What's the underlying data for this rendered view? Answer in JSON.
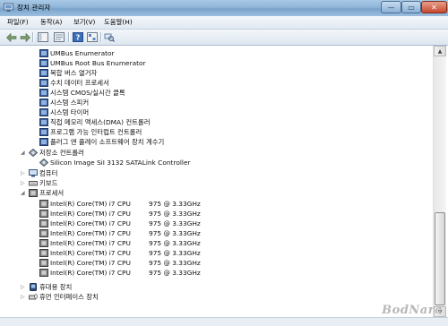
{
  "window": {
    "title": "장치 관리자",
    "buttons": {
      "minimize": "—",
      "maximize": "▭",
      "close": "✕"
    }
  },
  "menu": [
    {
      "label": "파일(F)"
    },
    {
      "label": "동작(A)"
    },
    {
      "label": "보기(V)"
    },
    {
      "label": "도움말(H)"
    }
  ],
  "toolbar": {
    "icons": [
      "back-icon",
      "forward-icon",
      "show-hide-tree-icon",
      "properties-icon",
      "help-icon",
      "scan-hardware-icon"
    ]
  },
  "tree": {
    "system_devices_children": [
      "UMBus Enumerator",
      "UMBus Root Bus Enumerator",
      "복합 버스 열거자",
      "수치 데이터 프로세서",
      "시스템 CMOS/실시간 클록",
      "시스템 스피커",
      "시스템 타이머",
      "직접 메모리 액세스(DMA) 컨트롤러",
      "프로그램 가능 인터럽트 컨트롤러",
      "플러그 앤 플레이 소프트웨어 장치 계수기"
    ],
    "storage": {
      "label": "저장소 컨트롤러",
      "children": [
        "Silicon Image SiI 3132 SATALink Controller"
      ]
    },
    "computer": "컴퓨터",
    "keyboard": "키보드",
    "processors": {
      "label": "프로세서",
      "children": [
        {
          "name": "Intel(R) Core(TM) i7 CPU",
          "speed": "975  @ 3.33GHz"
        },
        {
          "name": "Intel(R) Core(TM) i7 CPU",
          "speed": "975  @ 3.33GHz"
        },
        {
          "name": "Intel(R) Core(TM) i7 CPU",
          "speed": "975  @ 3.33GHz"
        },
        {
          "name": "Intel(R) Core(TM) i7 CPU",
          "speed": "975  @ 3.33GHz"
        },
        {
          "name": "Intel(R) Core(TM) i7 CPU",
          "speed": "975  @ 3.33GHz"
        },
        {
          "name": "Intel(R) Core(TM) i7 CPU",
          "speed": "975  @ 3.33GHz"
        },
        {
          "name": "Intel(R) Core(TM) i7 CPU",
          "speed": "975  @ 3.33GHz"
        },
        {
          "name": "Intel(R) Core(TM) i7 CPU",
          "speed": "975  @ 3.33GHz"
        }
      ]
    },
    "portable_devices": "휴대용 장치",
    "hid": "휴먼 인터페이스 장치"
  },
  "scrollbar": {
    "position_fraction": 0.62,
    "visible_fraction": 0.36
  },
  "watermark": "BodNara"
}
